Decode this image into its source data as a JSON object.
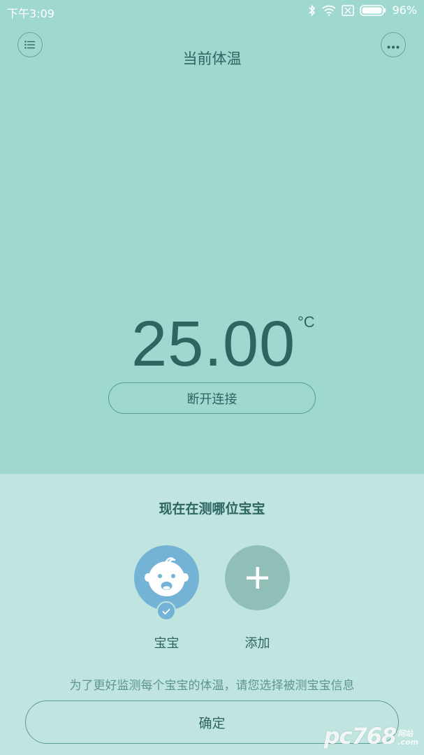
{
  "status_bar": {
    "time": "下午3:09",
    "battery_percent": "96%",
    "icons": [
      "bluetooth-icon",
      "wifi-icon",
      "sim-none-icon",
      "battery-icon"
    ]
  },
  "header": {
    "title": "当前体温",
    "left_icon": "list-icon",
    "right_icon": "more-icon"
  },
  "temperature": {
    "value": "25.00",
    "unit": "°C"
  },
  "disconnect_label": "断开连接",
  "selector": {
    "title": "现在在测哪位宝宝",
    "profiles": [
      {
        "label": "宝宝",
        "icon": "baby-face-icon",
        "selected": true
      },
      {
        "label": "添加",
        "icon": "plus-icon",
        "selected": false
      }
    ],
    "hint": "为了更好监测每个宝宝的体温，请您选择被测宝宝信息"
  },
  "confirm_label": "确定",
  "watermark": {
    "main": "pc768",
    "side_top": "网站",
    "side_bottom": ".com"
  },
  "colors": {
    "top_bg": "#9fd8cf",
    "bottom_bg": "#c0e4df",
    "text": "#2d6561",
    "baby_avatar": "#74b3d6",
    "add_avatar": "#8fbfb6"
  }
}
